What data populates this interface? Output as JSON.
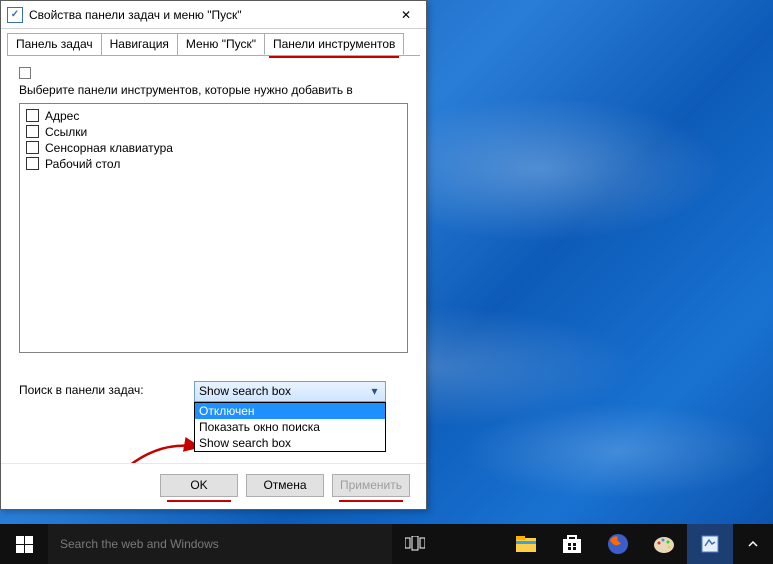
{
  "window": {
    "title": "Свойства панели задач и меню \"Пуск\"",
    "close_glyph": "✕"
  },
  "tabs": {
    "items": [
      "Панель задач",
      "Навигация",
      "Меню \"Пуск\"",
      "Панели инструментов"
    ],
    "active_index": 3
  },
  "instructions": "Выберите панели инструментов, которые нужно добавить в",
  "toolbars": [
    {
      "label": "Адрес",
      "checked": false
    },
    {
      "label": "Ссылки",
      "checked": false
    },
    {
      "label": "Сенсорная клавиатура",
      "checked": false
    },
    {
      "label": "Рабочий стол",
      "checked": false
    }
  ],
  "search_row": {
    "label": "Поиск в панели задач:",
    "selected": "Show search box",
    "options": [
      "Отключен",
      "Показать окно поиска",
      "Show search box"
    ],
    "highlight_index": 0
  },
  "buttons": {
    "ok": "OK",
    "cancel": "Отмена",
    "apply": "Применить"
  },
  "taskbar": {
    "search_placeholder": "Search the web and Windows"
  },
  "icons": {
    "task_view": "task-view-icon",
    "explorer": "file-explorer-icon",
    "store": "store-icon",
    "firefox": "firefox-icon",
    "paint": "paint-icon",
    "app": "app-icon",
    "chevron": "▾"
  }
}
